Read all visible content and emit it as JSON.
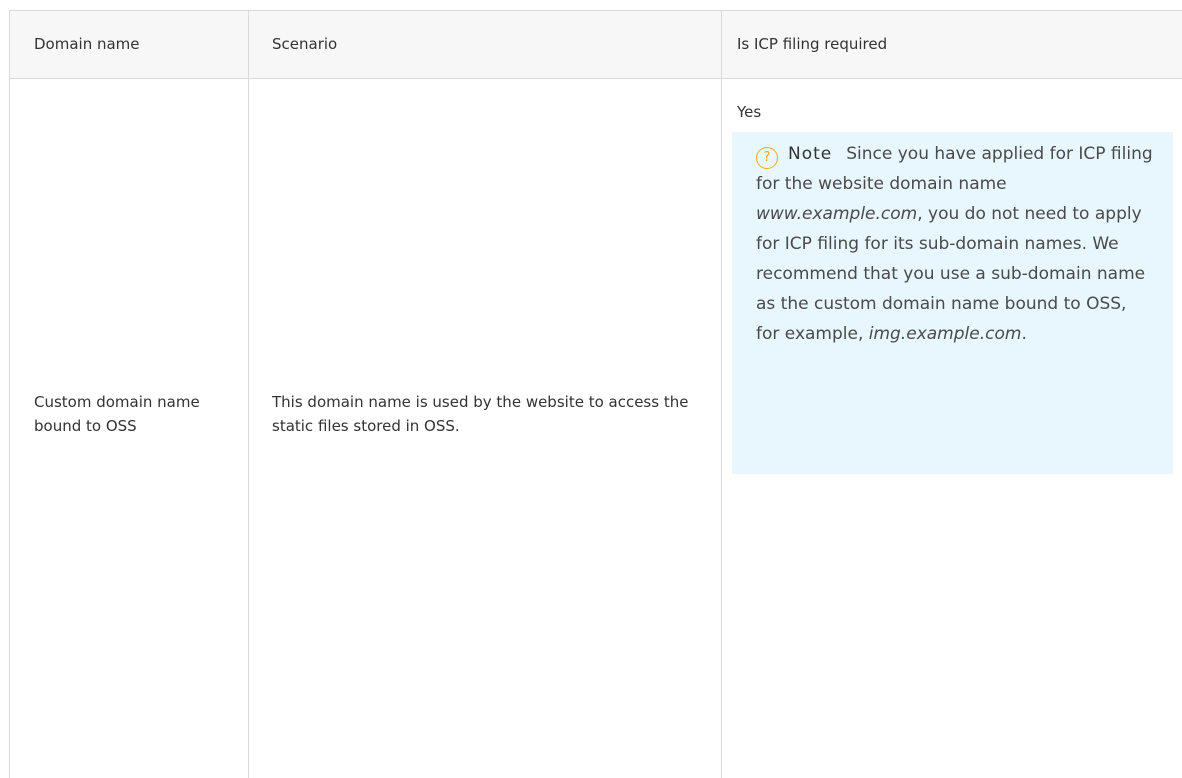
{
  "table": {
    "headers": {
      "domain": "Domain name",
      "scenario": "Scenario",
      "icp": "Is ICP filing required"
    },
    "rows": [
      {
        "domain": "Custom domain name bound to OSS",
        "scenario": "This domain name is used by the website to access the static files stored in OSS.",
        "icp_value": "Yes",
        "note": {
          "label": "Note",
          "text_before": "Since you have applied for ICP filing for the website domain name ",
          "italic_1": "www.example.com",
          "text_middle": ", you do not need to apply for ICP filing for its sub-domain names. We recommend that you use a sub-domain name as the custom domain name bound to OSS, for example, ",
          "italic_2": "img.example.com",
          "text_after": "."
        }
      }
    ]
  },
  "colors": {
    "header_bg": "#f7f7f7",
    "border": "#d9d9d9",
    "note_bg": "#e8f6fd",
    "note_icon": "#f5a623"
  },
  "icons": {
    "note_icon": "question-circle-icon"
  }
}
